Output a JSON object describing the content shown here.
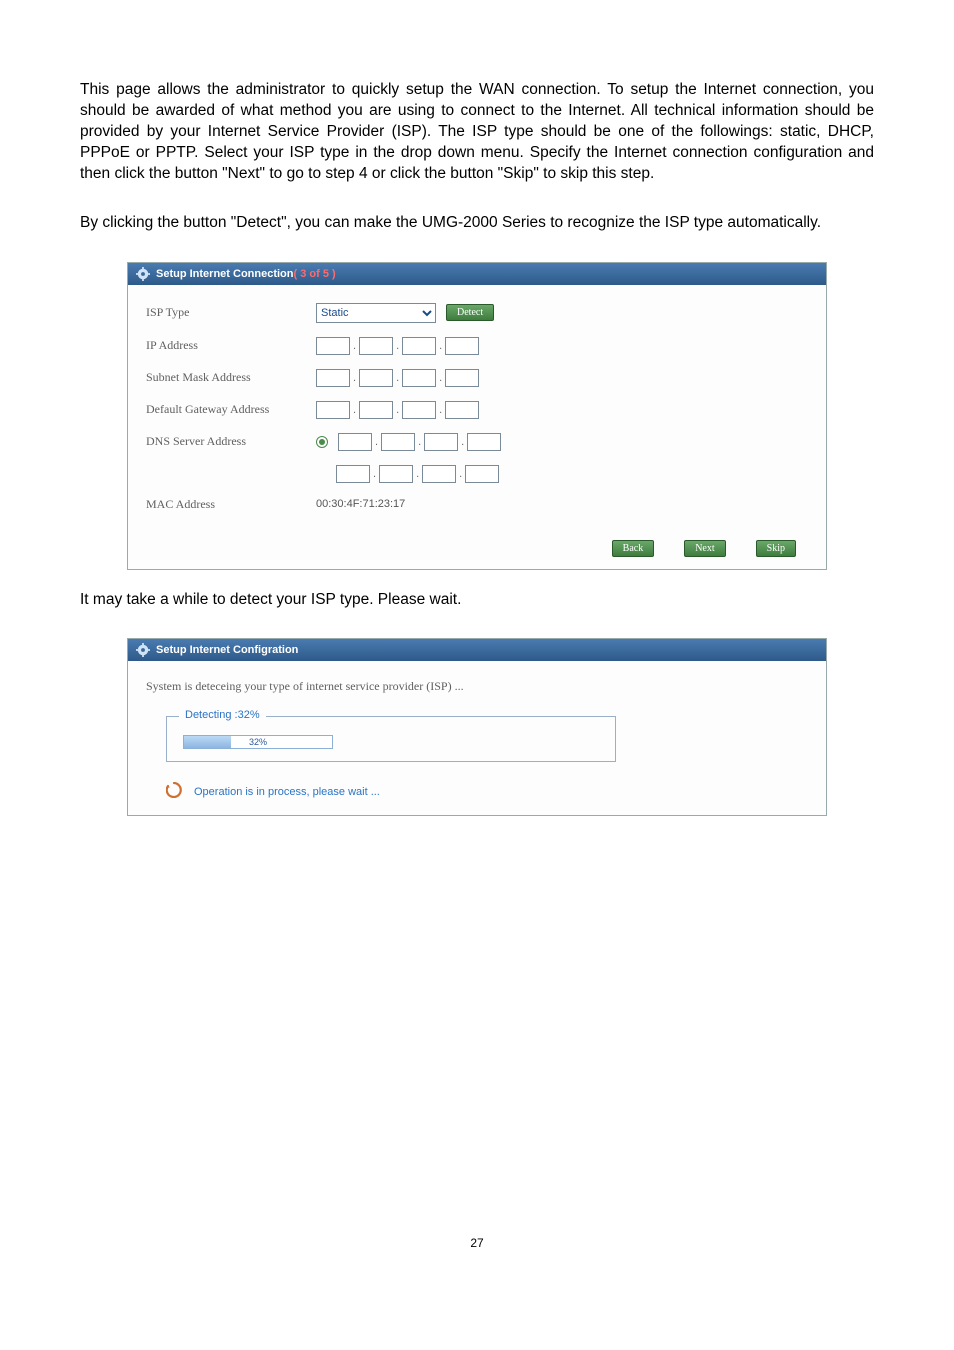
{
  "paragraph1": "This page allows the administrator to quickly setup the WAN connection. To setup the Internet connection, you should be awarded of what method you are using to connect to the Internet. All technical information should be provided by your Internet Service Provider (ISP). The ISP type should be one of the followings: static, DHCP, PPPoE or PPTP. Select your ISP type in the drop down menu. Specify the Internet connection configuration and then click the button \"Next\" to go to step 4 or click the button \"Skip\" to skip this step.",
  "paragraph2": "By clicking the button \"Detect\", you can make the UMG-2000 Series to recognize the ISP type automatically.",
  "paragraph3": "It may take a while to detect your ISP type. Please wait.",
  "page_number": "27",
  "panel1": {
    "title_prefix": "Setup Internet Connection ",
    "title_step": "( 3 of 5 )",
    "labels": {
      "isp_type": "ISP Type",
      "ip_address": "IP Address",
      "subnet_mask": "Subnet Mask Address",
      "default_gateway": "Default Gateway Address",
      "dns_server": "DNS Server Address",
      "mac_address": "MAC Address"
    },
    "isp_selected": "Static",
    "detect_btn": "Detect",
    "mac_value": "00:30:4F:71:23:17",
    "buttons": {
      "back": "Back",
      "next": "Next",
      "skip": "Skip"
    }
  },
  "panel2": {
    "title": "Setup Internet Configration",
    "note": "System is deteceing your type of internet service provider (ISP) ...",
    "legend": "Detecting :32%",
    "bar_percent": 32,
    "bar_text": "32%",
    "status": "Operation is in process, please wait ..."
  }
}
